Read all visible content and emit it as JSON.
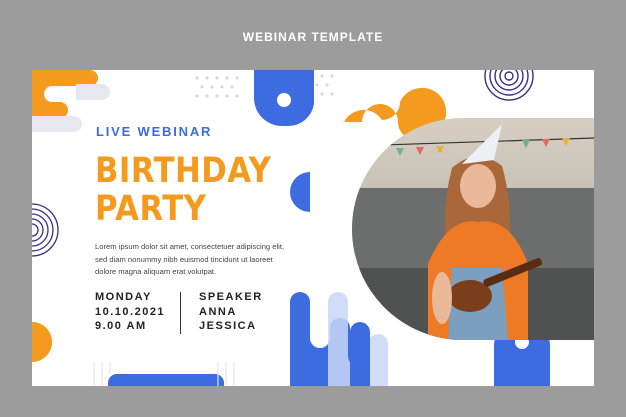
{
  "page_title": "WEBINAR TEMPLATE",
  "card": {
    "tag": "LIVE WEBINAR",
    "headline_line1": "BIRTHDAY",
    "headline_line2": "PARTY",
    "body_line1": "Lorem ipsum dolor sit amet, consectetuer adipiscing elit,",
    "body_line2": "sed diam nonummy nibh euismod tincidunt ut laoreet",
    "body_line3": "dolore magna aliquam erat volutpat.",
    "day": "MONDAY",
    "date": "10.10.2021",
    "time": "9.00 AM",
    "speaker_label": "SPEAKER",
    "speaker_first": "ANNA",
    "speaker_last": "JESSICA"
  },
  "colors": {
    "orange": "#f39a1f",
    "blue": "#3d6be0",
    "light_blue": "#c9d6f6",
    "background": "#9c9c9c"
  }
}
